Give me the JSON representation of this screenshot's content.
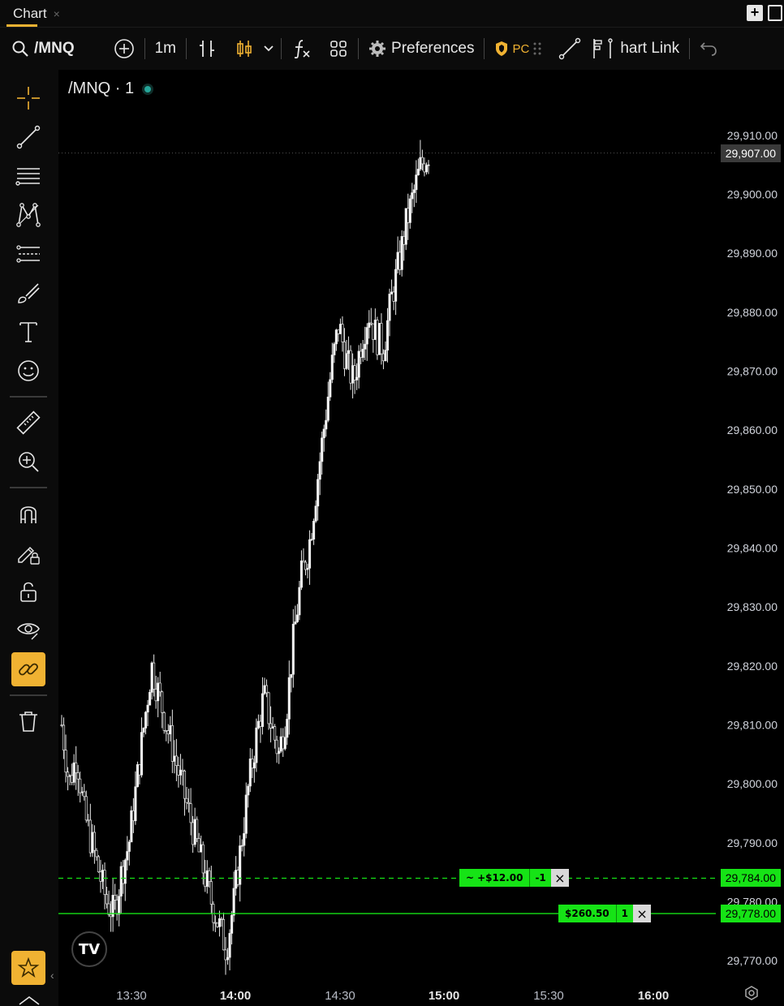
{
  "tab": {
    "title": "Chart",
    "close": "×"
  },
  "toolbar": {
    "symbol": "/MNQ",
    "interval": "1m",
    "preferences": "Preferences",
    "pc_label": "PC",
    "chart_link": "hart Link"
  },
  "legend": {
    "title": "/MNQ · 1"
  },
  "colors": {
    "accent": "#f0b232",
    "order_green": "#16e316",
    "candle": "#ffffff",
    "background": "#000000"
  },
  "chart_data": {
    "type": "candlestick",
    "symbol": "/MNQ",
    "interval": "1m",
    "ylim": [
      29767,
      29917
    ],
    "y_ticks": [
      "29,910.00",
      "29,900.00",
      "29,890.00",
      "29,880.00",
      "29,870.00",
      "29,860.00",
      "29,850.00",
      "29,840.00",
      "29,830.00",
      "29,820.00",
      "29,810.00",
      "29,800.00",
      "29,790.00",
      "29,780.00",
      "29,770.00"
    ],
    "y_tick_values": [
      29910,
      29900,
      29890,
      29880,
      29870,
      29860,
      29850,
      29840,
      29830,
      29820,
      29810,
      29800,
      29790,
      29780,
      29770
    ],
    "x_ticks": [
      {
        "label": "13:30",
        "bold": false
      },
      {
        "label": "14:00",
        "bold": true
      },
      {
        "label": "14:30",
        "bold": false
      },
      {
        "label": "15:00",
        "bold": true
      },
      {
        "label": "15:30",
        "bold": false
      },
      {
        "label": "16:00",
        "bold": true
      }
    ],
    "last_price": 29907.0,
    "last_price_label": "29,907.00",
    "close_path": [
      29810,
      29800,
      29805,
      29795,
      29790,
      29785,
      29780,
      29778,
      29785,
      29790,
      29800,
      29810,
      29820,
      29815,
      29810,
      29805,
      29800,
      29795,
      29790,
      29785,
      29780,
      29776,
      29772,
      29780,
      29790,
      29800,
      29808,
      29815,
      29810,
      29805,
      29812,
      29825,
      29835,
      29840,
      29850,
      29860,
      29870,
      29878,
      29872,
      29868,
      29875,
      29880,
      29876,
      29874,
      29882,
      29888,
      29895,
      29900,
      29905,
      29907
    ],
    "orders": [
      {
        "pnl": "+$12.00",
        "qty": "-1",
        "price": 29784.0,
        "price_label": "29,784.00",
        "style": "dashed"
      },
      {
        "pnl": "$260.50",
        "qty": "1",
        "price": 29778.0,
        "price_label": "29,778.00",
        "style": "solid"
      }
    ]
  }
}
